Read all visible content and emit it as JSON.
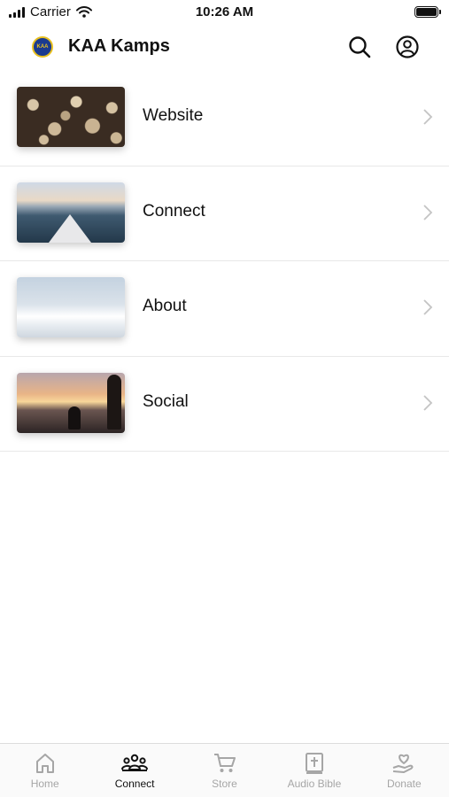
{
  "status_bar": {
    "carrier": "Carrier",
    "time": "10:26 AM"
  },
  "header": {
    "logo_text": "KAA",
    "title": "KAA Kamps"
  },
  "list": {
    "items": [
      {
        "label": "Website"
      },
      {
        "label": "Connect"
      },
      {
        "label": "About"
      },
      {
        "label": "Social"
      }
    ]
  },
  "tabbar": {
    "tabs": [
      {
        "label": "Home",
        "icon": "home-icon"
      },
      {
        "label": "Connect",
        "icon": "group-icon"
      },
      {
        "label": "Store",
        "icon": "cart-icon"
      },
      {
        "label": "Audio Bible",
        "icon": "bible-icon"
      },
      {
        "label": "Donate",
        "icon": "donate-icon"
      }
    ],
    "active": "Connect"
  },
  "colors": {
    "text": "#111111",
    "inactive_tab": "#a6a6a6",
    "divider": "#e8e8e8",
    "logo_blue": "#1a3a8f",
    "logo_gold": "#e8c020"
  }
}
